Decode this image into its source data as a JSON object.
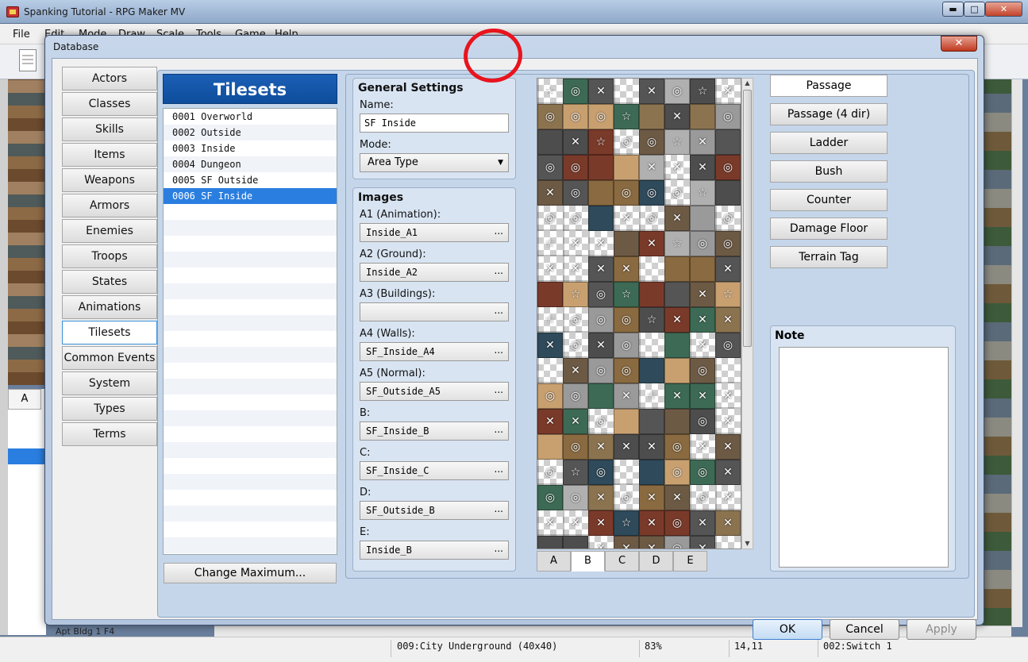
{
  "app": {
    "title": "Spanking Tutorial - RPG Maker MV",
    "menu": [
      "File",
      "Edit",
      "Mode",
      "Draw",
      "Scale",
      "Tools",
      "Game",
      "Help"
    ],
    "window_controls": {
      "minimize": "▬",
      "maximize": "□",
      "close": "✕"
    }
  },
  "background": {
    "tree_tab": "A",
    "map_name": "Apt Bldg 1 F4"
  },
  "status_bar": {
    "map": "009:City Underground (40x40)",
    "zoom": "83%",
    "coords": "14,11",
    "switch": "002:Switch 1"
  },
  "dialog": {
    "title": "Database",
    "close": "✕",
    "categories": [
      "Actors",
      "Classes",
      "Skills",
      "Items",
      "Weapons",
      "Armors",
      "Enemies",
      "Troops",
      "States",
      "Animations",
      "Tilesets",
      "Common Events",
      "System",
      "Types",
      "Terms"
    ],
    "active_category": "Tilesets",
    "list_header": "Tilesets",
    "tilesets": [
      "0001 Overworld",
      "0002 Outside",
      "0003 Inside",
      "0004 Dungeon",
      "0005 SF Outside",
      "0006 SF Inside"
    ],
    "selected_tileset": "0006 SF Inside",
    "change_max_label": "Change Maximum...",
    "general": {
      "title": "General Settings",
      "name_label": "Name:",
      "name_value": "SF Inside",
      "mode_label": "Mode:",
      "mode_value": "Area Type"
    },
    "images": {
      "title": "Images",
      "fields": [
        {
          "label": "A1 (Animation):",
          "value": "Inside_A1"
        },
        {
          "label": "A2 (Ground):",
          "value": "Inside_A2"
        },
        {
          "label": "A3 (Buildings):",
          "value": ""
        },
        {
          "label": "A4 (Walls):",
          "value": "SF_Inside_A4"
        },
        {
          "label": "A5 (Normal):",
          "value": "SF_Outside_A5"
        },
        {
          "label": "B:",
          "value": "SF_Inside_B"
        },
        {
          "label": "C:",
          "value": "SF_Inside_C"
        },
        {
          "label": "D:",
          "value": "SF_Outside_B"
        },
        {
          "label": "E:",
          "value": "Inside_B"
        }
      ],
      "browse_label": "..."
    },
    "tile_tabs": [
      "A",
      "B",
      "C",
      "D",
      "E"
    ],
    "active_tile_tab": "B",
    "flag_buttons": [
      "Passage",
      "Passage (4 dir)",
      "Ladder",
      "Bush",
      "Counter",
      "Damage Floor",
      "Terrain Tag"
    ],
    "active_flag": "Passage",
    "note_title": "Note",
    "buttons": {
      "ok": "OK",
      "cancel": "Cancel",
      "apply": "Apply"
    },
    "palette_glyphs": {
      "star": "☆",
      "circle": "◎",
      "cross": "✕"
    }
  },
  "colors": {
    "selection": "#2a7ee0",
    "header": "#1b5fb5",
    "annotation": "#e8141e"
  }
}
